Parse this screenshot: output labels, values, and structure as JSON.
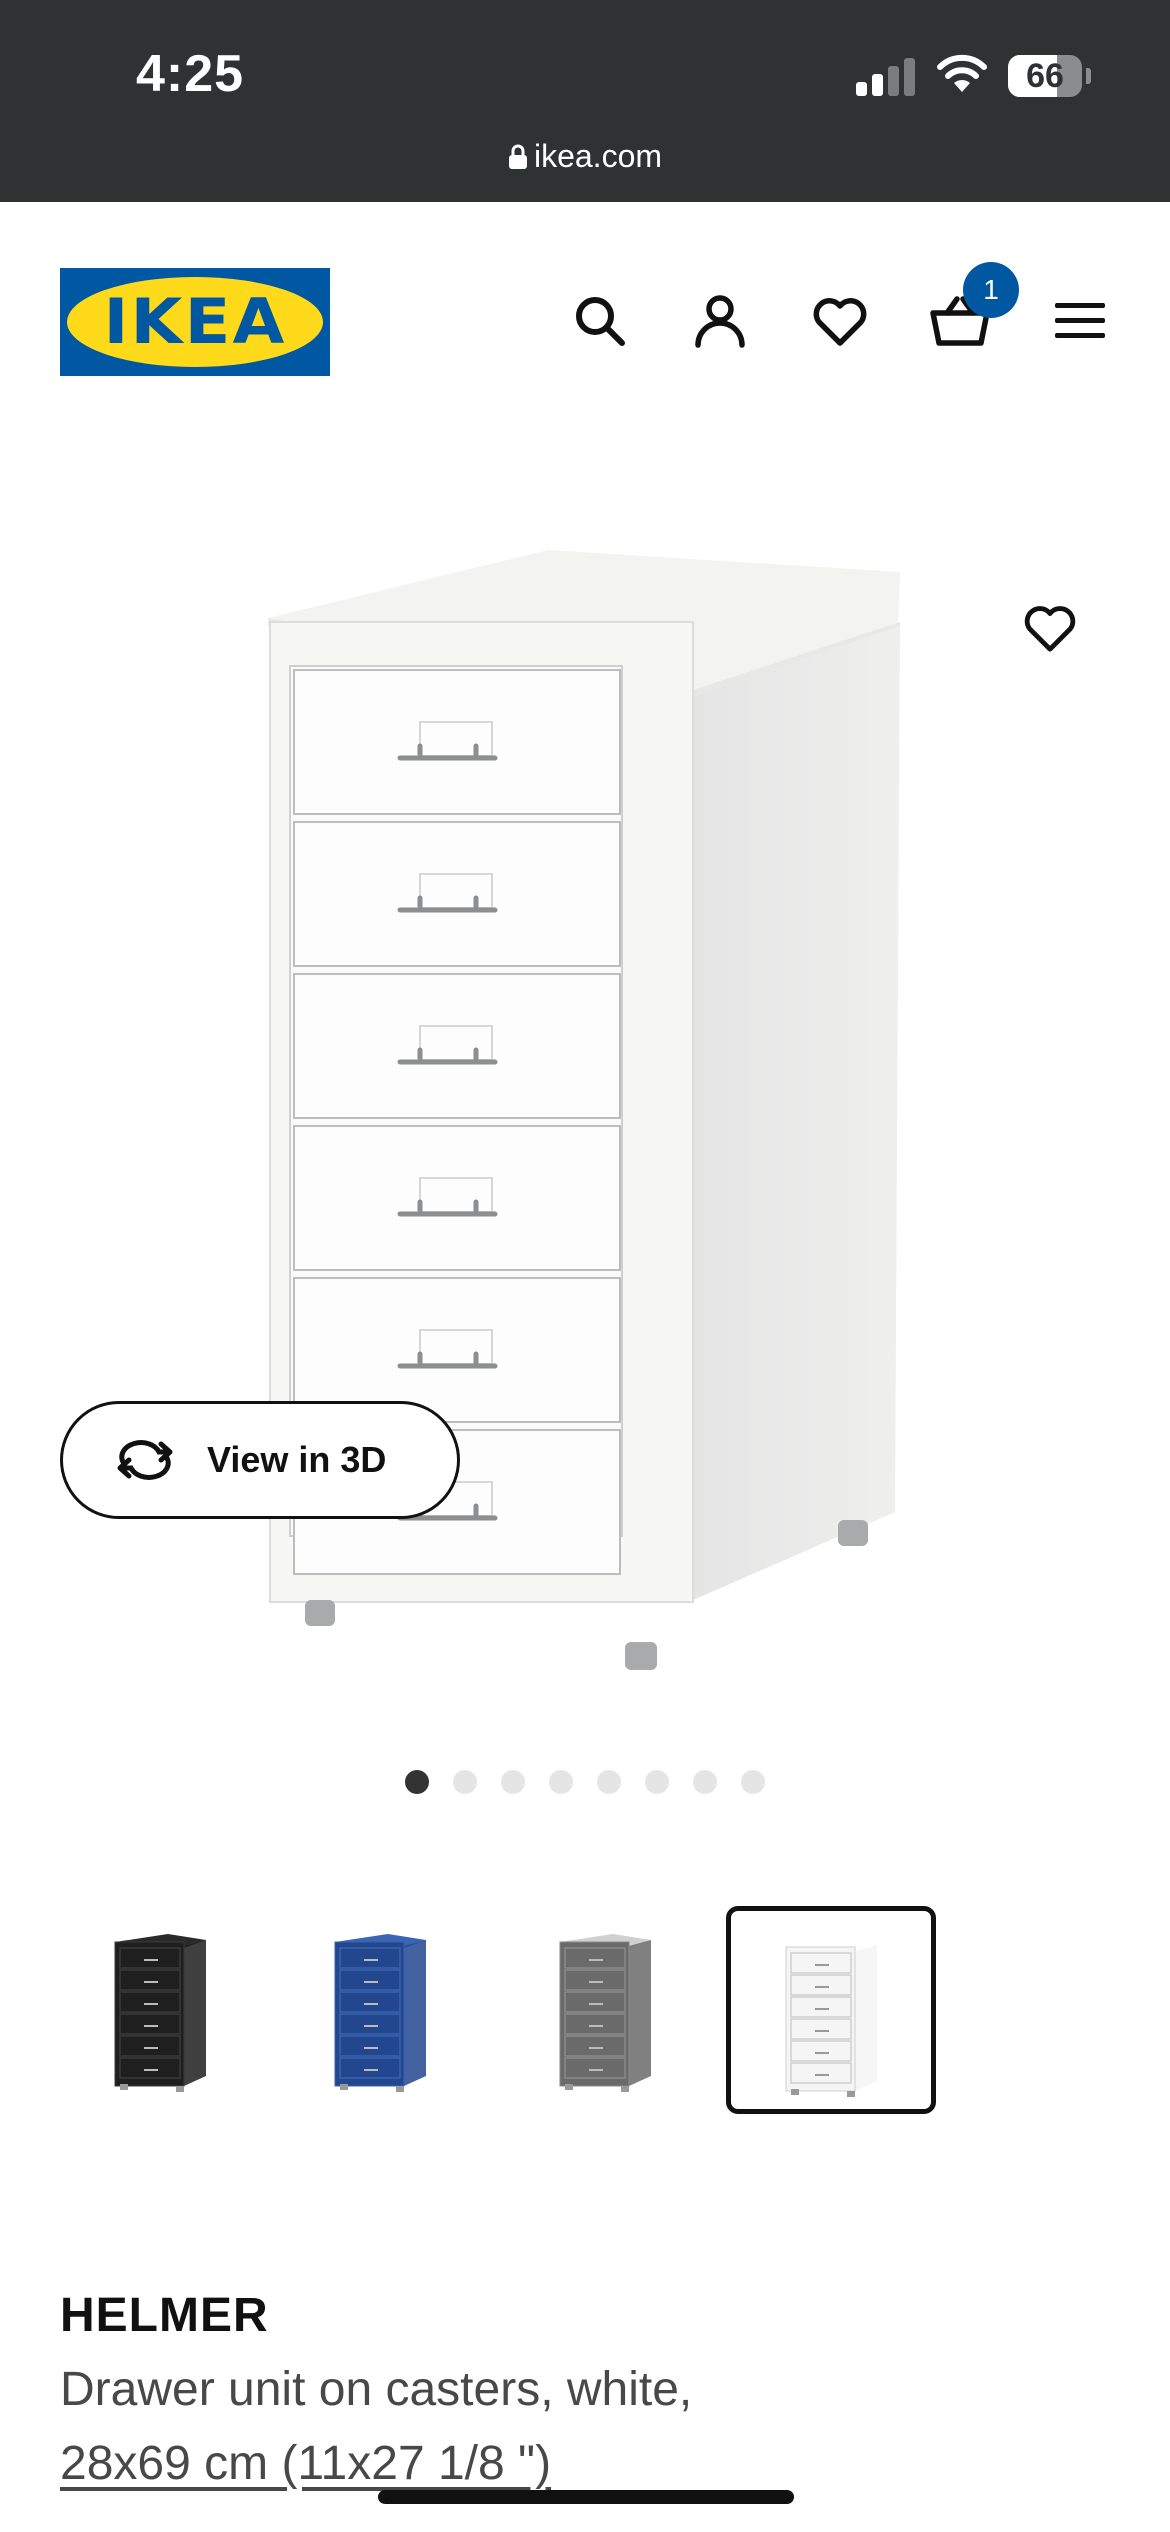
{
  "status_bar": {
    "time": "4:25",
    "battery": "66",
    "battery_level": 0.66,
    "url": "ikea.com"
  },
  "header": {
    "logo_text": "IKEA",
    "icons": [
      "search-icon",
      "account-icon",
      "heart-icon",
      "cart-icon",
      "menu-icon"
    ],
    "cart_count": "1",
    "colors": {
      "brand_blue": "#0058a3",
      "brand_yellow": "#ffda1a"
    }
  },
  "gallery": {
    "view3d_label": "View in 3D",
    "image_count": 8,
    "active_index": 0
  },
  "thumbnails": [
    {
      "color": "black-brown",
      "selected": false
    },
    {
      "color": "blue",
      "selected": false
    },
    {
      "color": "grey",
      "selected": false
    },
    {
      "color": "white",
      "selected": true
    }
  ],
  "product": {
    "name": "HELMER",
    "description": "Drawer unit on casters, white,",
    "size": "28x69 cm (11x27 1/8 \")"
  }
}
